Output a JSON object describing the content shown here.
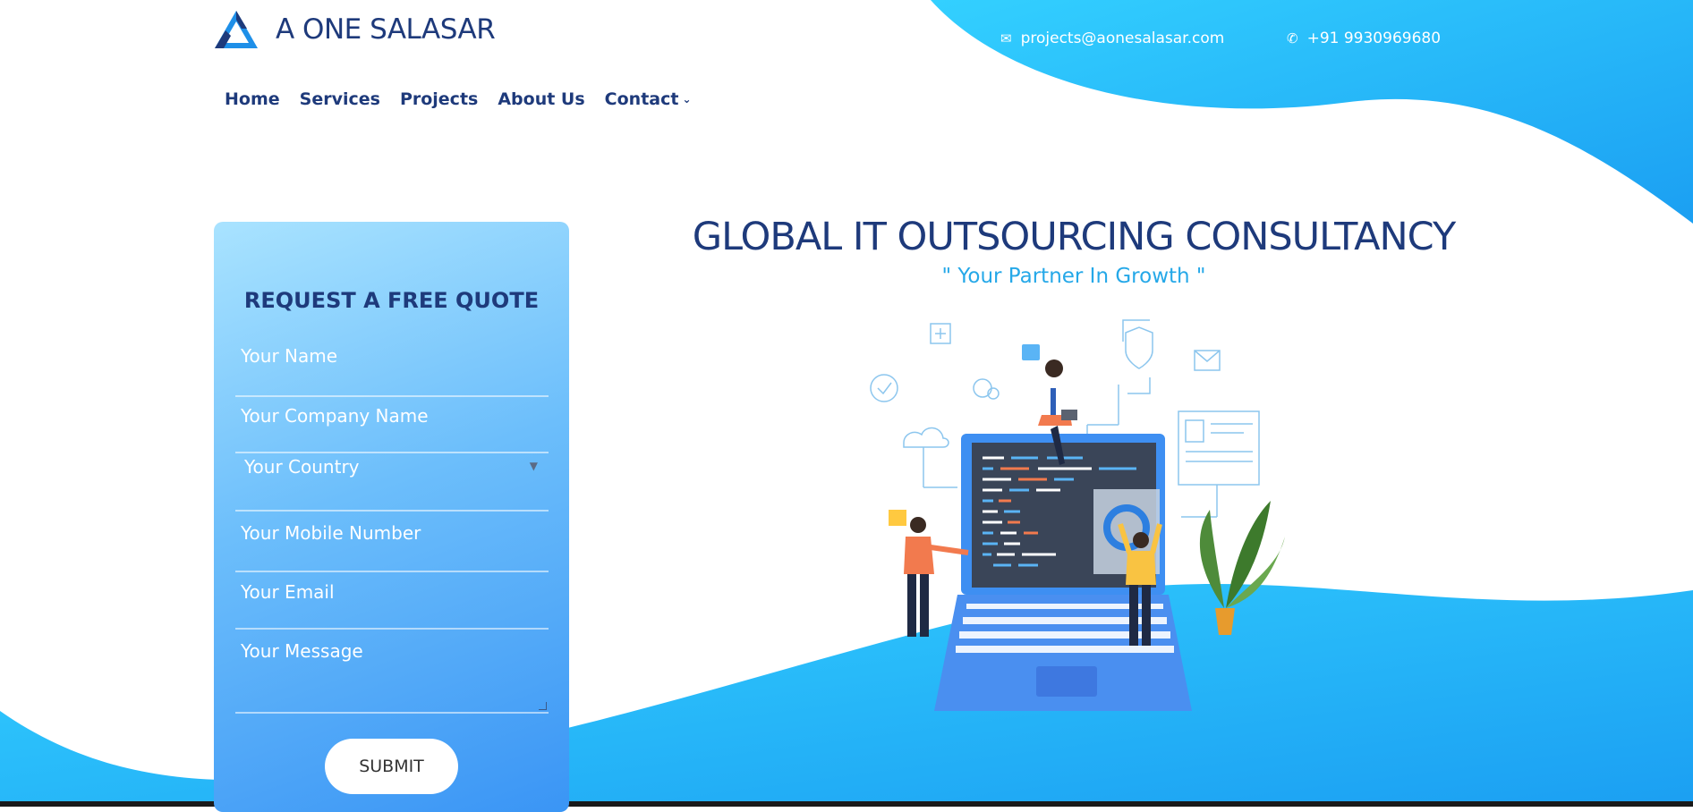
{
  "brand": {
    "name": "A ONE SALASAR"
  },
  "nav": [
    {
      "label": "Home"
    },
    {
      "label": "Services"
    },
    {
      "label": "Projects"
    },
    {
      "label": "About Us"
    },
    {
      "label": "Contact",
      "has_dropdown": true
    }
  ],
  "contact": {
    "email": "projects@aonesalasar.com",
    "phone": "+91 9930969680",
    "email_icon": "envelope-icon",
    "phone_icon": "phone-icon"
  },
  "quote_form": {
    "title": "REQUEST A FREE QUOTE",
    "name_placeholder": "Your Name",
    "company_placeholder": "Your Company Name",
    "country_selected": "Your Country",
    "mobile_placeholder": "Your Mobile Number",
    "email_placeholder": "Your Email",
    "message_placeholder": "Your Message",
    "submit_label": "SUBMIT"
  },
  "hero": {
    "title": "GLOBAL IT OUTSOURCING CONSULTANCY",
    "subtitle": "\" Your Partner In Growth \""
  },
  "colors": {
    "brand_navy": "#1e3a7b",
    "accent_blue": "#25a8e8",
    "wave_cyan": "#2ec7ff",
    "wave_blue": "#1ea8f5"
  }
}
